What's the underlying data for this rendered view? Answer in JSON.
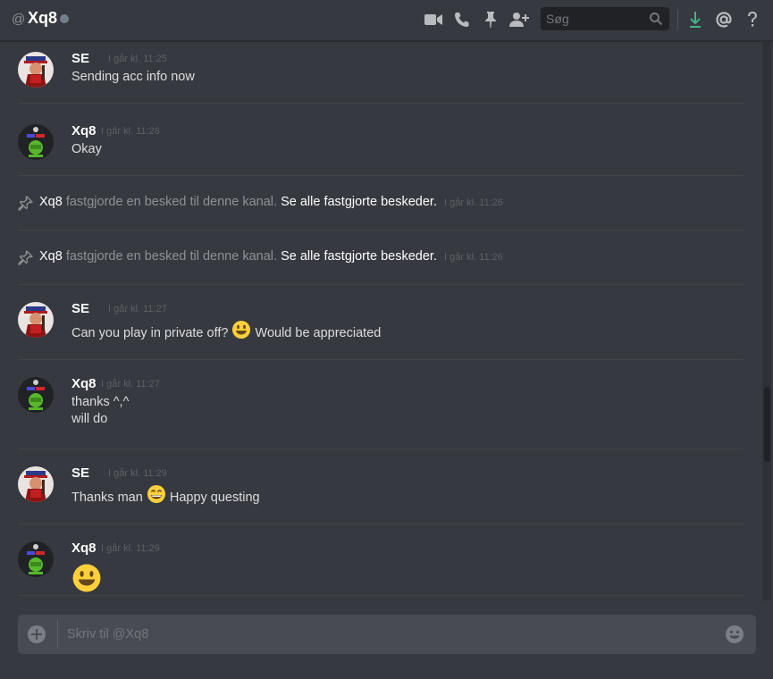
{
  "header": {
    "at_symbol": "@",
    "channel_name": "Xq8",
    "status_color": "#747f8d",
    "search_placeholder": "Søg",
    "icons": [
      "video-icon",
      "phone-icon",
      "pin-icon",
      "add-member-icon",
      "search-icon",
      "download-icon",
      "mention-icon",
      "help-icon"
    ]
  },
  "messages": [
    {
      "author": "SE",
      "timestamp": "I går kl. 11:25",
      "lines": [
        "Sending acc info now"
      ]
    },
    {
      "author": "Xq8",
      "timestamp": "I går kl. 11:26",
      "lines": [
        "Okay"
      ]
    },
    {
      "author": "SE",
      "timestamp": "I går kl. 11:27",
      "line_a": "Can you play in private off?",
      "line_b": "Would be appreciated",
      "emoji": "smiley"
    },
    {
      "author": "Xq8",
      "timestamp": "I går kl. 11:27",
      "lines": [
        "thanks ^,^",
        "will do"
      ]
    },
    {
      "author": "SE",
      "timestamp": "I går kl. 11:29",
      "line_a": "Thanks man",
      "line_b": "Happy questing",
      "emoji": "smile"
    },
    {
      "author": "Xq8",
      "timestamp": "I går kl. 11:29",
      "emoji": "smiley-large"
    }
  ],
  "system_messages": [
    {
      "actor": "Xq8",
      "action": "fastgjorde en besked til denne kanal.",
      "link": "Se alle fastgjorte beskeder.",
      "timestamp": "I går kl. 11:26"
    },
    {
      "actor": "Xq8",
      "action": "fastgjorde en besked til denne kanal.",
      "link": "Se alle fastgjorte beskeder.",
      "timestamp": "I går kl. 11:26"
    }
  ],
  "composer": {
    "placeholder": "Skriv til @Xq8"
  },
  "colors": {
    "background": "#36393f",
    "accent_download": "#43b581",
    "username": "#ffffff",
    "text": "#dcddde",
    "timestamp": "#5d6066"
  }
}
